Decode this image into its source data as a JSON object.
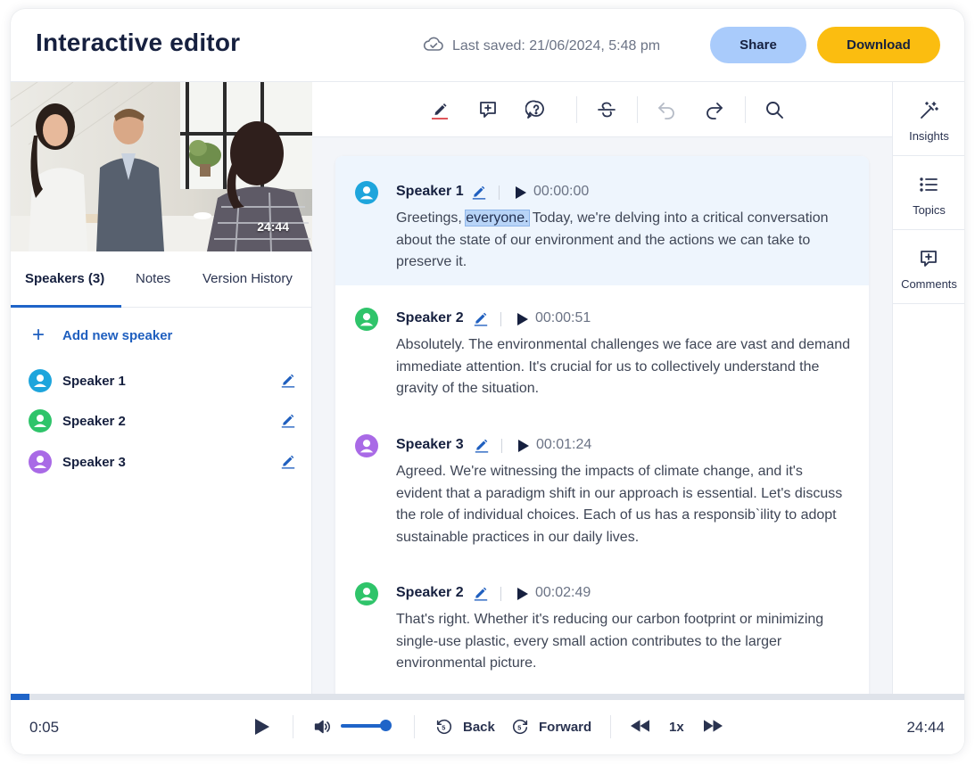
{
  "header": {
    "title": "Interactive editor",
    "last_saved": "Last saved: 21/06/2024, 5:48 pm",
    "share_label": "Share",
    "download_label": "Download"
  },
  "video": {
    "duration": "24:44"
  },
  "left_tabs": [
    {
      "label": "Speakers (3)",
      "active": true
    },
    {
      "label": "Notes",
      "active": false
    },
    {
      "label": "Version History",
      "active": false
    }
  ],
  "speakers_panel": {
    "add_label": "Add new speaker",
    "speakers": [
      {
        "name": "Speaker 1",
        "color": "#1ea5dc"
      },
      {
        "name": "Speaker 2",
        "color": "#2fc46a"
      },
      {
        "name": "Speaker 3",
        "color": "#a96ae6"
      }
    ]
  },
  "toolbar": {
    "icons": [
      "highlighter-icon",
      "add-comment-icon",
      "question-icon",
      "strikethrough-icon",
      "undo-icon",
      "redo-icon",
      "search-icon"
    ]
  },
  "transcript": [
    {
      "speaker": "Speaker 1",
      "color": "#1ea5dc",
      "time": "00:00:00",
      "text_before": "Greetings, ",
      "highlighted": "everyone.",
      "text_after": " Today, we're delving into a critical conversation about the state of our environment and the actions we can take to preserve it."
    },
    {
      "speaker": "Speaker 2",
      "color": "#2fc46a",
      "time": "00:00:51",
      "text": "Absolutely. The environmental challenges we face are vast and demand immediate attention. It's crucial for us to collectively understand the gravity of the situation."
    },
    {
      "speaker": "Speaker 3",
      "color": "#a96ae6",
      "time": "00:01:24",
      "text": "Agreed. We're witnessing the impacts of climate change, and it's evident that a paradigm shift in our approach is essential. Let's discuss the role of individual choices. Each of us has a responsib`ility to adopt sustainable practices in our daily lives."
    },
    {
      "speaker": "Speaker 2",
      "color": "#2fc46a",
      "time": "00:02:49",
      "text": "That's right. Whether it's reducing our carbon footprint or minimizing single-use plastic, every small action contributes to the larger environmental picture."
    }
  ],
  "right_nav": [
    {
      "label": "Insights",
      "icon": "magic-wand-icon"
    },
    {
      "label": "Topics",
      "icon": "list-icon"
    },
    {
      "label": "Comments",
      "icon": "comment-plus-icon"
    }
  ],
  "player": {
    "current_time": "0:05",
    "total_time": "24:44",
    "back_label": "Back",
    "forward_label": "Forward",
    "speed": "1x",
    "progress": 0.02,
    "volume": 0.9
  },
  "colors": {
    "accent": "#1f64c8",
    "share_bg": "#a9cbfb",
    "download_bg": "#fbbd10",
    "highlight_row": "#eef5fd"
  }
}
